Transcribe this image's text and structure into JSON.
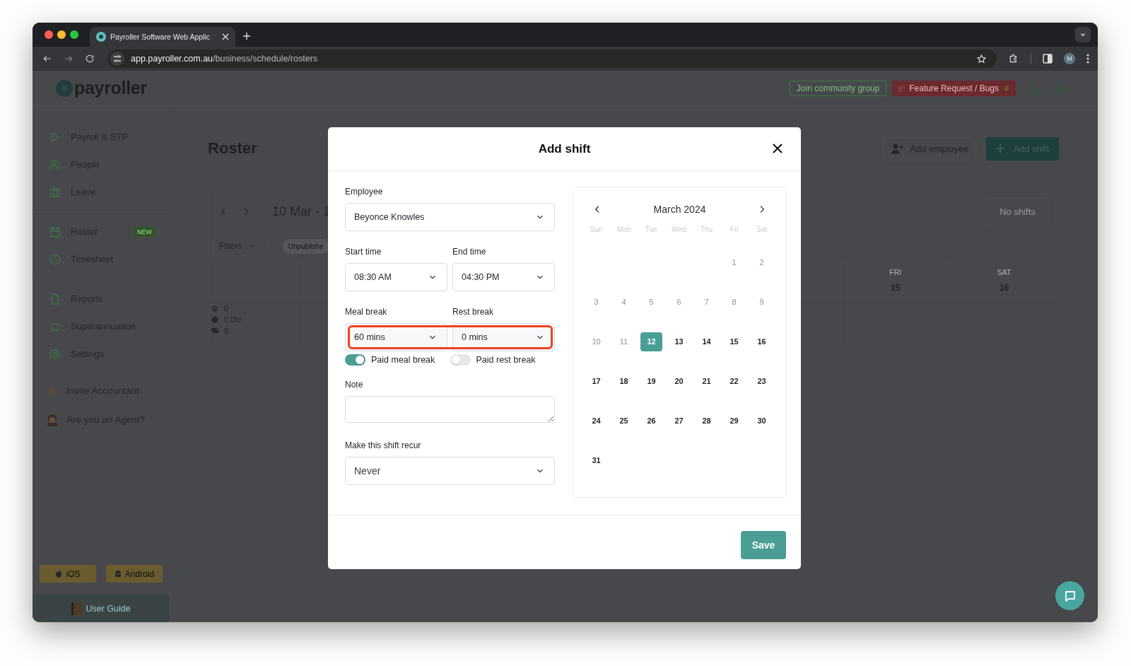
{
  "browser": {
    "tab_title": "Payroller Software Web Applic",
    "url_host": "app.payroller.com.au",
    "url_path": "/business/schedule/rosters",
    "profile_initial": "M"
  },
  "app_header": {
    "logo": "payroller",
    "community_button": "Join community group",
    "feature_button": "Feature Request / Bugs"
  },
  "sidebar": {
    "groups": [
      [
        {
          "label": "Payroll & STP"
        },
        {
          "label": "People"
        },
        {
          "label": "Leave"
        }
      ],
      [
        {
          "label": "Roster",
          "badge": "NEW"
        },
        {
          "label": "Timesheet"
        }
      ],
      [
        {
          "label": "Reports"
        },
        {
          "label": "Superannuation"
        },
        {
          "label": "Settings"
        }
      ]
    ],
    "extras": [
      {
        "label": "Invite Accountant"
      },
      {
        "label": "Are you an Agent?"
      }
    ],
    "app_buttons": [
      "iOS",
      "Android"
    ],
    "user_guide": "User Guide"
  },
  "roster": {
    "title": "Roster",
    "add_employee": "Add employee",
    "add_shift": "Add shift",
    "date_range": "10 Mar - 1",
    "filters": "Filters",
    "status_chip": "Unpublishe",
    "no_shifts": "No shifts",
    "days": [
      {
        "weekday": "FRI",
        "date": "15"
      },
      {
        "weekday": "SAT",
        "date": "16"
      }
    ],
    "stats": [
      "0",
      "0.0hr",
      "0"
    ]
  },
  "modal": {
    "title": "Add shift",
    "employee": {
      "label": "Employee",
      "value": "Beyonce Knowles"
    },
    "times": [
      {
        "label": "Start time",
        "value": "08:30 AM"
      },
      {
        "label": "End time",
        "value": "04:30 PM"
      }
    ],
    "breaks": {
      "highlighted": true,
      "fields": [
        {
          "label": "Meal break",
          "value": "60 mins"
        },
        {
          "label": "Rest break",
          "value": "0 mins"
        }
      ]
    },
    "toggles": [
      {
        "label": "Paid meal break",
        "on": true
      },
      {
        "label": "Paid rest break",
        "on": false
      }
    ],
    "note": {
      "label": "Note"
    },
    "recur": {
      "label": "Make this shift recur",
      "value": "Never"
    },
    "save": "Save",
    "calendar": {
      "month": "March 2024",
      "weekdays": [
        "Sun",
        "Mon",
        "Tue",
        "Wed",
        "Thu",
        "Fri",
        "Sat"
      ],
      "weeks": [
        [
          {
            "day": "1",
            "past": true,
            "selected": false
          },
          {
            "day": "2",
            "past": true,
            "selected": false
          }
        ],
        [
          {
            "day": "3",
            "past": true,
            "selected": false
          },
          {
            "day": "4",
            "past": true,
            "selected": false
          },
          {
            "day": "5",
            "past": true,
            "selected": false
          },
          {
            "day": "6",
            "past": true,
            "selected": false
          },
          {
            "day": "7",
            "past": true,
            "selected": false
          },
          {
            "day": "8",
            "past": true,
            "selected": false
          },
          {
            "day": "9",
            "past": true,
            "selected": false
          }
        ],
        [
          {
            "day": "10",
            "past": true,
            "selected": false
          },
          {
            "day": "11",
            "past": true,
            "selected": false
          },
          {
            "day": "12",
            "past": false,
            "selected": true
          },
          {
            "day": "13",
            "past": false,
            "selected": false
          },
          {
            "day": "14",
            "past": false,
            "selected": false
          },
          {
            "day": "15",
            "past": false,
            "selected": false
          },
          {
            "day": "16",
            "past": false,
            "selected": false
          }
        ],
        [
          {
            "day": "17",
            "past": false,
            "selected": false
          },
          {
            "day": "18",
            "past": false,
            "selected": false
          },
          {
            "day": "19",
            "past": false,
            "selected": false
          },
          {
            "day": "20",
            "past": false,
            "selected": false
          },
          {
            "day": "21",
            "past": false,
            "selected": false
          },
          {
            "day": "22",
            "past": false,
            "selected": false
          },
          {
            "day": "23",
            "past": false,
            "selected": false
          }
        ],
        [
          {
            "day": "24",
            "past": false,
            "selected": false
          },
          {
            "day": "25",
            "past": false,
            "selected": false
          },
          {
            "day": "26",
            "past": false,
            "selected": false
          },
          {
            "day": "27",
            "past": false,
            "selected": false
          },
          {
            "day": "28",
            "past": false,
            "selected": false
          },
          {
            "day": "29",
            "past": false,
            "selected": false
          },
          {
            "day": "30",
            "past": false,
            "selected": false
          }
        ],
        [
          {
            "day": "31",
            "past": false,
            "selected": false
          }
        ]
      ]
    }
  }
}
